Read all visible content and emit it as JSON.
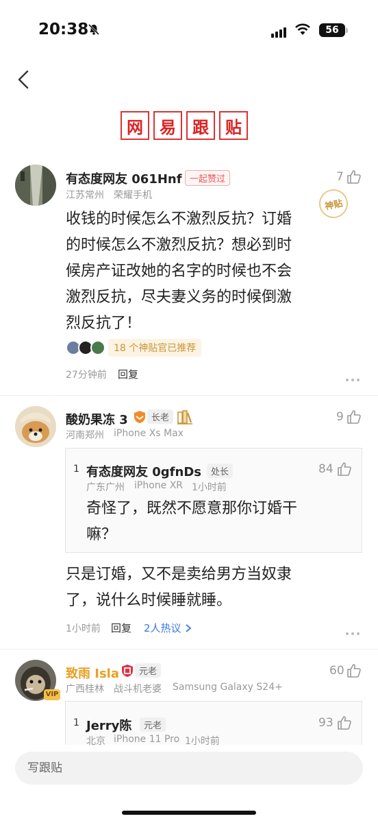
{
  "status_bar": {
    "time": "20:38",
    "battery": "56"
  },
  "header": {
    "logo_chars": [
      "网",
      "易",
      "跟",
      "贴"
    ]
  },
  "comments": [
    {
      "username": "有态度网友 061Hnf",
      "badge": "一起赞过",
      "location": "江苏常州",
      "device": "荣耀手机",
      "likes": "7",
      "stamp": "神贴",
      "text_lines": [
        "收钱的时候怎么不激烈反抗？订婚",
        "的时候怎么不激烈反抗？想必到时",
        "候房产证改她的名字的时候也不会",
        "激烈反抗，尽夫妻义务的时候倒激",
        "烈反抗了！"
      ],
      "recommend": "18 个神贴官已推荐",
      "time": "27分钟前",
      "reply_label": "回复"
    },
    {
      "username": "酸奶果冻 3",
      "badge": "长老",
      "location": "河南郑州",
      "device": "iPhone Xs Max",
      "likes": "9",
      "quote": {
        "index": "1",
        "username": "有态度网友 0gfnDs",
        "badge": "处长",
        "location": "广东广州",
        "device": "iPhone XR",
        "time": "1小时前",
        "likes": "84",
        "text_lines": [
          "奇怪了，既然不愿意那你订婚干",
          "嘛？"
        ]
      },
      "text_lines": [
        "只是订婚，又不是卖给男方当奴隶",
        "了，说什么时候睡就睡。"
      ],
      "time": "1小时前",
      "reply_label": "回复",
      "discussion": "2人热议"
    },
    {
      "username": "致雨 Isla",
      "badge": "元老",
      "vip": "VIP",
      "location": "广西桂林",
      "device": "战斗机老婆",
      "device2": "Samsung Galaxy S24+",
      "likes": "60",
      "quote": {
        "index": "1",
        "username": "Jerry陈",
        "badge": "元老",
        "location": "北京",
        "device": "iPhone 11 Pro",
        "time": "1小时前",
        "likes": "93"
      }
    }
  ],
  "footer": {
    "write_placeholder": "写跟贴"
  },
  "colors": {
    "accent": "#d22222",
    "gold_name": "#e8a020",
    "muted": "#999999"
  }
}
